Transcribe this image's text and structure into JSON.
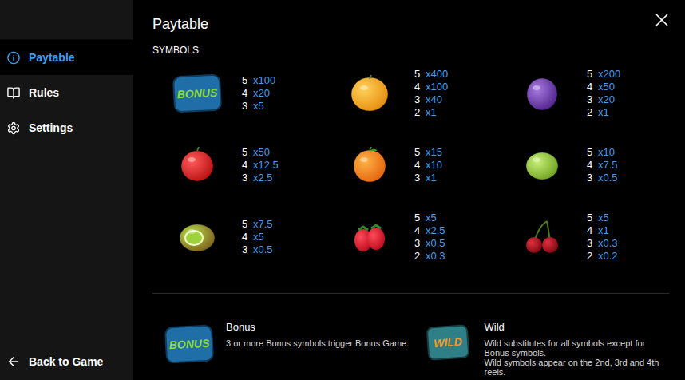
{
  "sidebar": {
    "items": [
      {
        "label": "Paytable",
        "kind": "info",
        "selected": true
      },
      {
        "label": "Rules",
        "kind": "book",
        "selected": false
      },
      {
        "label": "Settings",
        "kind": "gear",
        "selected": false
      }
    ],
    "back": {
      "label": "Back to Game"
    }
  },
  "page": {
    "title": "Paytable",
    "section": "SYMBOLS"
  },
  "symbols": [
    {
      "kind": "bonus",
      "icon_text": "BONUS",
      "pays": [
        {
          "count": "5",
          "multiplier": "x100"
        },
        {
          "count": "4",
          "multiplier": "x20"
        },
        {
          "count": "3",
          "multiplier": "x5"
        }
      ]
    },
    {
      "kind": "melon",
      "pays": [
        {
          "count": "5",
          "multiplier": "x400"
        },
        {
          "count": "4",
          "multiplier": "x100"
        },
        {
          "count": "3",
          "multiplier": "x40"
        },
        {
          "count": "2",
          "multiplier": "x1"
        }
      ]
    },
    {
      "kind": "plum",
      "pays": [
        {
          "count": "5",
          "multiplier": "x200"
        },
        {
          "count": "4",
          "multiplier": "x50"
        },
        {
          "count": "3",
          "multiplier": "x20"
        },
        {
          "count": "2",
          "multiplier": "x1"
        }
      ]
    },
    {
      "kind": "apple",
      "pays": [
        {
          "count": "5",
          "multiplier": "x50"
        },
        {
          "count": "4",
          "multiplier": "x12.5"
        },
        {
          "count": "3",
          "multiplier": "x2.5"
        }
      ]
    },
    {
      "kind": "orange",
      "pays": [
        {
          "count": "5",
          "multiplier": "x15"
        },
        {
          "count": "4",
          "multiplier": "x10"
        },
        {
          "count": "3",
          "multiplier": "x1"
        }
      ]
    },
    {
      "kind": "lime",
      "pays": [
        {
          "count": "5",
          "multiplier": "x10"
        },
        {
          "count": "4",
          "multiplier": "x7.5"
        },
        {
          "count": "3",
          "multiplier": "x0.5"
        }
      ]
    },
    {
      "kind": "kiwi",
      "pays": [
        {
          "count": "5",
          "multiplier": "x7.5"
        },
        {
          "count": "4",
          "multiplier": "x5"
        },
        {
          "count": "3",
          "multiplier": "x0.5"
        }
      ]
    },
    {
      "kind": "strawberry",
      "pays": [
        {
          "count": "5",
          "multiplier": "x5"
        },
        {
          "count": "4",
          "multiplier": "x2.5"
        },
        {
          "count": "3",
          "multiplier": "x0.5"
        },
        {
          "count": "2",
          "multiplier": "x0.3"
        }
      ]
    },
    {
      "kind": "cherry",
      "pays": [
        {
          "count": "5",
          "multiplier": "x5"
        },
        {
          "count": "4",
          "multiplier": "x1"
        },
        {
          "count": "3",
          "multiplier": "x0.3"
        },
        {
          "count": "2",
          "multiplier": "x0.2"
        }
      ]
    }
  ],
  "features": [
    {
      "kind": "bonus",
      "icon_text": "BONUS",
      "title": "Bonus",
      "lines": [
        "3 or more Bonus symbols trigger Bonus Game."
      ]
    },
    {
      "kind": "wild",
      "icon_text": "WILD",
      "title": "Wild",
      "lines": [
        "Wild substitutes for all symbols except for Bonus symbols.",
        "Wild symbols appear on the 2nd, 3rd and 4th reels."
      ]
    }
  ]
}
